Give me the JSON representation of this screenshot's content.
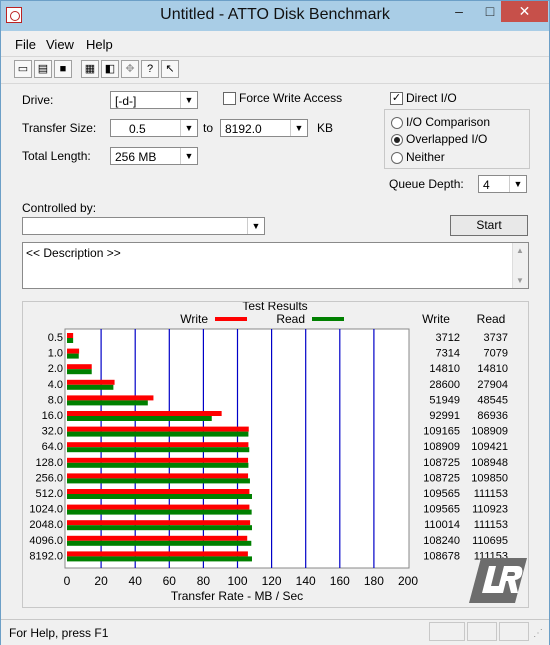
{
  "window": {
    "title": "Untitled - ATTO Disk Benchmark",
    "controls": [
      "–",
      "□",
      "✕"
    ]
  },
  "menu": [
    "File",
    "View",
    "Help"
  ],
  "toolbar_icons": [
    "new-icon",
    "open-icon",
    "save-icon",
    "print-icon",
    "print-preview-icon",
    "move-icon",
    "help-icon",
    "context-help-icon"
  ],
  "form": {
    "drive_label": "Drive:",
    "drive_value": "[-d-]",
    "transfer_size_label": "Transfer Size:",
    "transfer_from": "0.5",
    "to_label": "to",
    "transfer_to": "8192.0",
    "kb_label": "KB",
    "total_length_label": "Total Length:",
    "total_length_value": "256 MB",
    "force_write_label": "Force Write Access",
    "direct_io_label": "Direct I/O",
    "radio_io_comparison": "I/O Comparison",
    "radio_overlapped": "Overlapped I/O",
    "radio_neither": "Neither",
    "queue_depth_label": "Queue Depth:",
    "queue_depth_value": "4",
    "controlled_by_label": "Controlled by:",
    "controlled_by_value": "",
    "start_label": "Start",
    "description": "<< Description >>"
  },
  "status_text": "For Help, press F1",
  "chart_data": {
    "type": "bar",
    "title": "Test Results",
    "xlabel": "Transfer Rate - MB / Sec",
    "xlim": [
      0,
      200
    ],
    "xticks": [
      "0",
      "20",
      "40",
      "60",
      "80",
      "100",
      "120",
      "140",
      "160",
      "180",
      "200"
    ],
    "categories": [
      "0.5",
      "1.0",
      "2.0",
      "4.0",
      "8.0",
      "16.0",
      "32.0",
      "64.0",
      "128.0",
      "256.0",
      "512.0",
      "1024.0",
      "2048.0",
      "4096.0",
      "8192.0"
    ],
    "legend": {
      "write": "Write",
      "read": "Read"
    },
    "column_headers": [
      "Write",
      "Read"
    ],
    "series": [
      {
        "name": "Write",
        "color": "#ff0000",
        "values": [
          3.6,
          7.1,
          14.5,
          27.9,
          50.7,
          90.7,
          106.6,
          106.4,
          106.2,
          106.2,
          107.0,
          107.0,
          107.4,
          105.7,
          106.1
        ]
      },
      {
        "name": "Read",
        "color": "#008000",
        "values": [
          3.6,
          6.9,
          14.5,
          27.2,
          47.4,
          84.9,
          106.4,
          106.9,
          106.4,
          107.3,
          108.5,
          108.3,
          108.5,
          108.1,
          108.5
        ]
      }
    ],
    "write_values": [
      "3712",
      "7314",
      "14810",
      "28600",
      "51949",
      "92991",
      "109165",
      "108909",
      "108725",
      "108725",
      "109565",
      "109565",
      "110014",
      "108240",
      "108678"
    ],
    "read_values": [
      "3737",
      "7079",
      "14810",
      "27904",
      "48545",
      "86936",
      "108909",
      "109421",
      "108948",
      "109850",
      "111153",
      "110923",
      "111153",
      "110695",
      "111153"
    ]
  }
}
